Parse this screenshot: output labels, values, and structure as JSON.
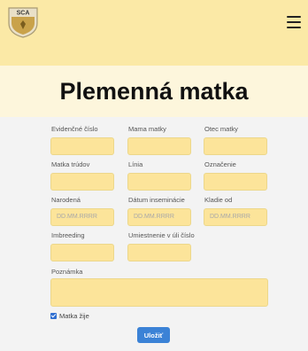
{
  "app": {
    "logo_text": "SCA"
  },
  "page": {
    "title": "Plemenná matka"
  },
  "form": {
    "fields": {
      "evidencne_cislo": {
        "label": "Evidenčné číslo",
        "value": "",
        "placeholder": ""
      },
      "mama_matky": {
        "label": "Mama matky",
        "value": "",
        "placeholder": ""
      },
      "otec_matky": {
        "label": "Otec matky",
        "value": "",
        "placeholder": ""
      },
      "matka_trudov": {
        "label": "Matka trúdov",
        "value": "",
        "placeholder": ""
      },
      "linia": {
        "label": "Línia",
        "value": "",
        "placeholder": ""
      },
      "oznacenie": {
        "label": "Označenie",
        "value": "",
        "placeholder": ""
      },
      "narodena": {
        "label": "Narodená",
        "value": "",
        "placeholder": "DD.MM.RRRR"
      },
      "datum_inseminacie": {
        "label": "Dátum inseminácie",
        "value": "",
        "placeholder": "DD.MM.RRRR"
      },
      "kladie_od": {
        "label": "Kladie od",
        "value": "",
        "placeholder": "DD.MM.RRRR"
      },
      "imbreeding": {
        "label": "Imbreeding",
        "value": "",
        "placeholder": ""
      },
      "umiestnenie": {
        "label": "Umiestnenie v úli číslo",
        "value": "",
        "placeholder": ""
      },
      "poznamka": {
        "label": "Poznámka",
        "value": "",
        "placeholder": ""
      }
    },
    "checkbox": {
      "label": "Matka žije",
      "checked": true
    },
    "save_label": "Uložiť"
  },
  "colors": {
    "header_bg": "#fbe9a6",
    "input_bg": "#fce49a",
    "button_bg": "#3b82d6"
  }
}
